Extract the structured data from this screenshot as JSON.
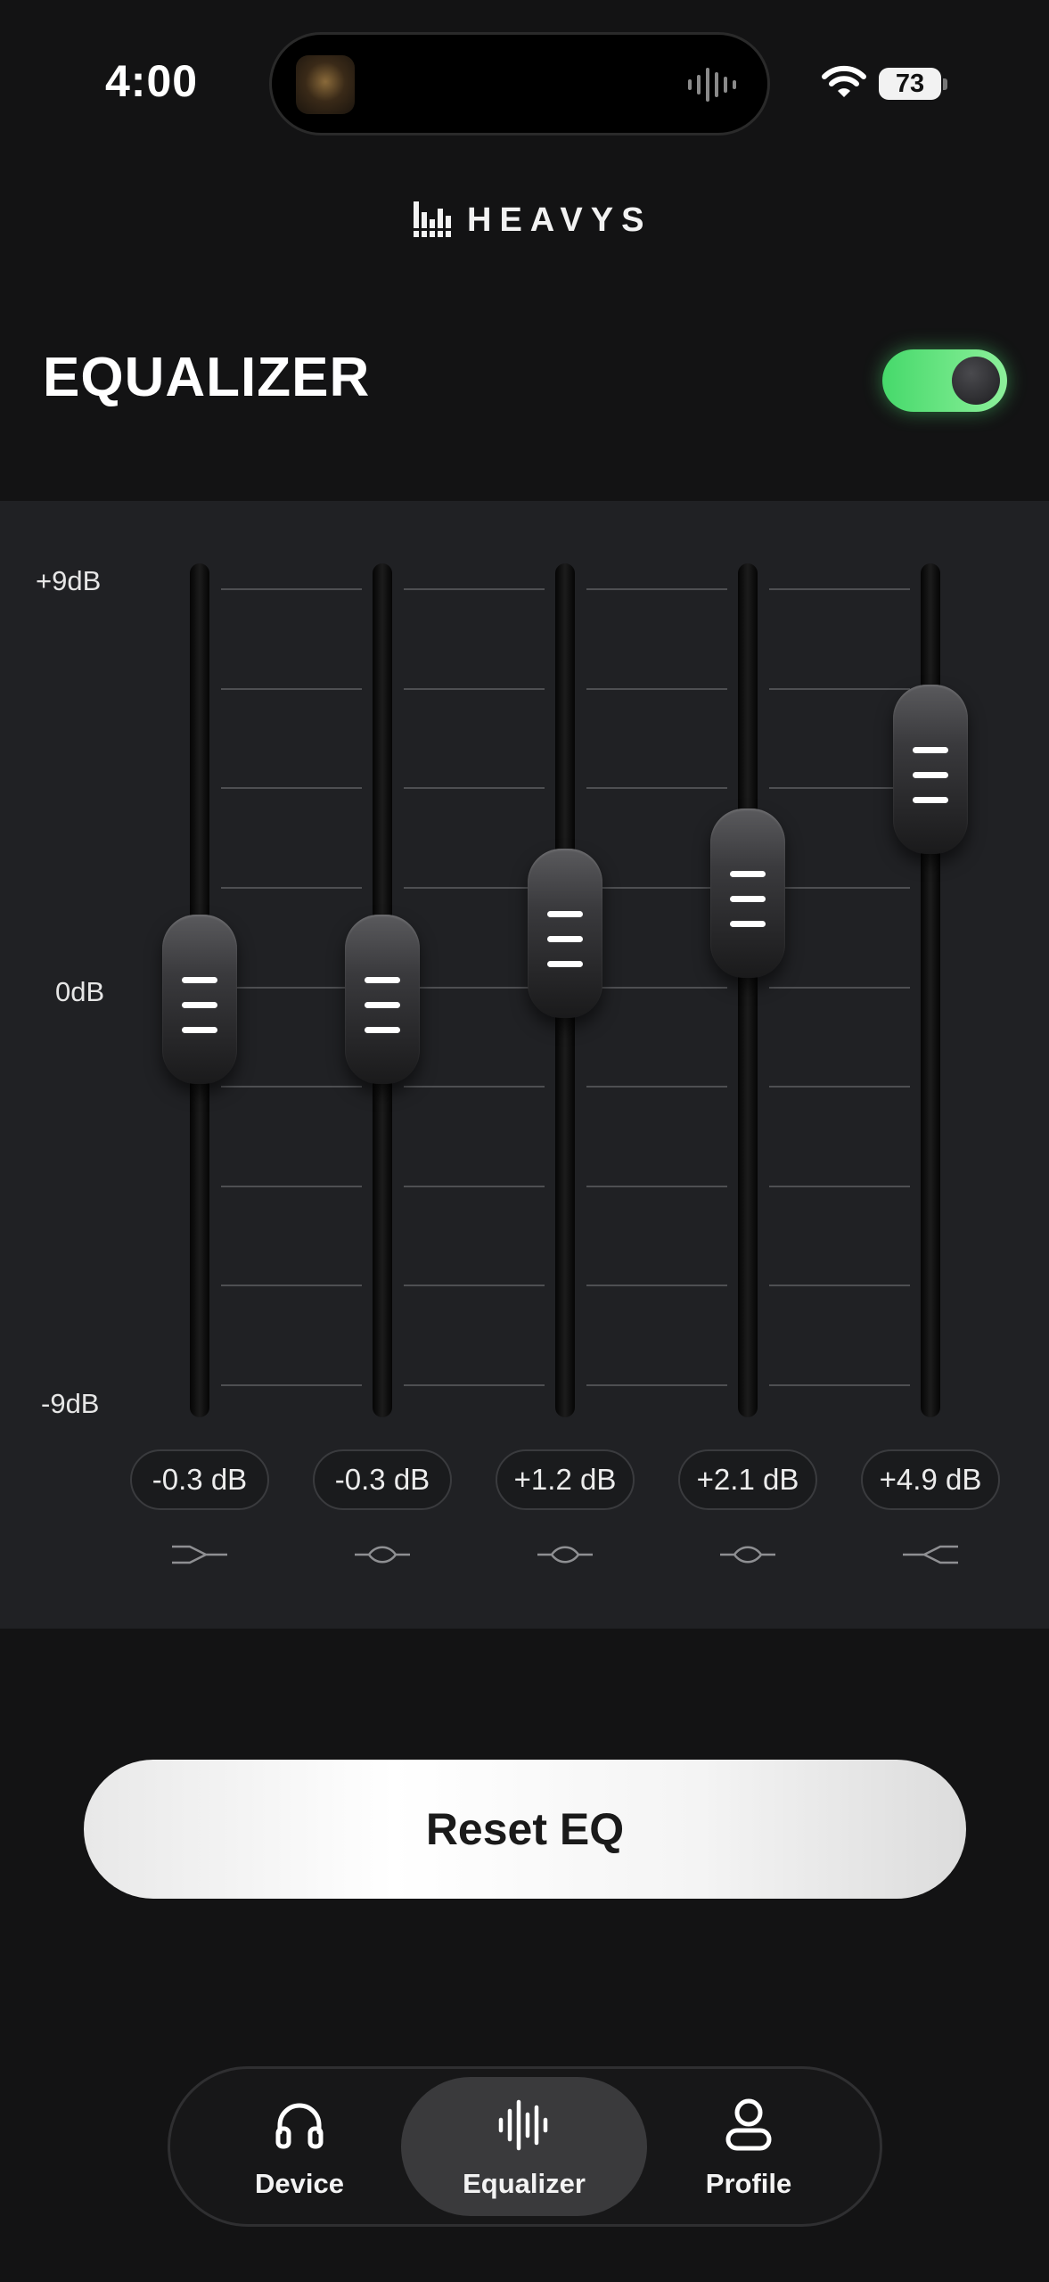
{
  "status_bar": {
    "time": "4:00",
    "battery": "73"
  },
  "brand": {
    "logo_text": "HEAVYS"
  },
  "header": {
    "title": "EQUALIZER",
    "eq_enabled": true
  },
  "equalizer": {
    "scale_labels": {
      "top": "+9dB",
      "middle": "0dB",
      "bottom": "-9dB"
    },
    "range_db": [
      -9,
      9
    ],
    "bands": [
      {
        "value_db": -0.3,
        "label": "-0.3 dB",
        "filter_icon": "low-shelf-icon"
      },
      {
        "value_db": -0.3,
        "label": "-0.3 dB",
        "filter_icon": "peak-icon"
      },
      {
        "value_db": 1.2,
        "label": "+1.2 dB",
        "filter_icon": "peak-icon"
      },
      {
        "value_db": 2.1,
        "label": "+2.1 dB",
        "filter_icon": "peak-icon"
      },
      {
        "value_db": 4.9,
        "label": "+4.9 dB",
        "filter_icon": "high-shelf-icon"
      }
    ]
  },
  "actions": {
    "reset_label": "Reset EQ"
  },
  "bottom_nav": {
    "active": "Equalizer",
    "items": [
      {
        "label": "Device",
        "icon": "headphones-icon"
      },
      {
        "label": "Equalizer",
        "icon": "waveform-icon"
      },
      {
        "label": "Profile",
        "icon": "person-icon"
      }
    ]
  },
  "colors": {
    "toggle_on": "#46d96b",
    "background": "#131314",
    "panel": "#202124"
  }
}
